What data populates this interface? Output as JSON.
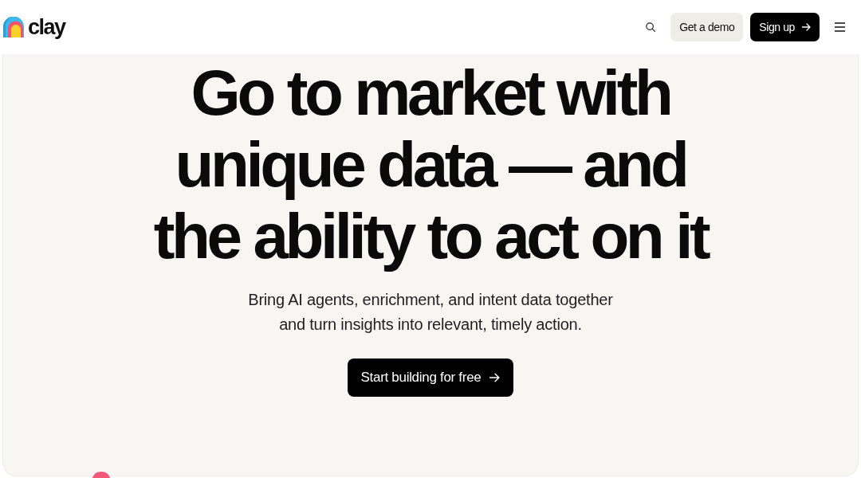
{
  "navbar": {
    "logo_text": "clay",
    "buttons": [
      {
        "label": "Get a demo",
        "kind": "secondary",
        "arrow": false
      },
      {
        "label": "Sign up",
        "kind": "primary",
        "arrow": true
      }
    ]
  },
  "hero": {
    "headline_lines": [
      "Go to market with",
      "unique data — and",
      "the ability to act on it"
    ],
    "subtitle_lines": [
      "Bring AI agents, enrichment, and intent data together",
      "and turn insights into relevant, timely action."
    ],
    "cta": {
      "label": "Start building for free",
      "arrow": true
    }
  }
}
